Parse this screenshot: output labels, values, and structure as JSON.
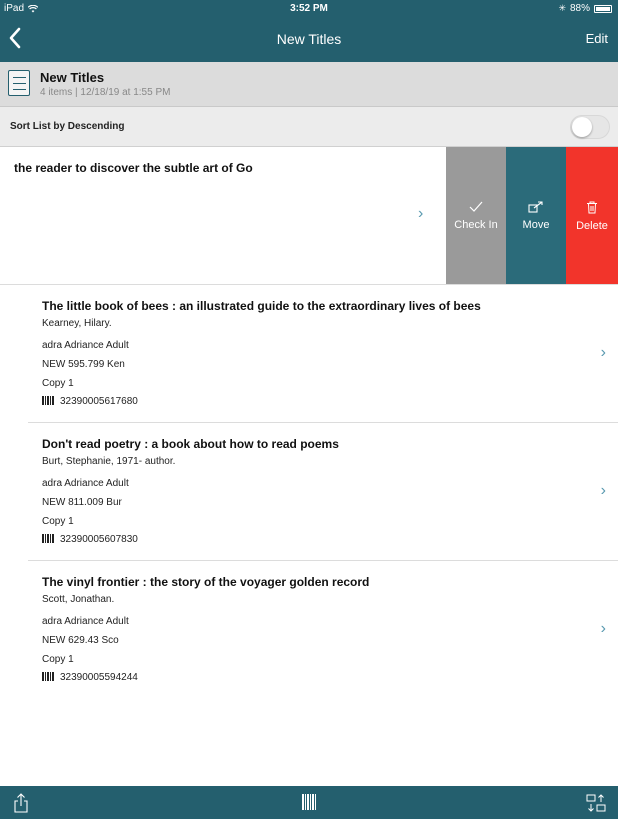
{
  "status_bar": {
    "device": "iPad",
    "time": "3:52 PM",
    "battery": "88%"
  },
  "nav": {
    "title": "New Titles",
    "edit_label": "Edit"
  },
  "list_header": {
    "title": "New Titles",
    "meta": "4 items  |  12/18/19 at 1:55 PM"
  },
  "sort": {
    "label": "Sort List by Descending",
    "enabled": false
  },
  "swiped_item": {
    "text": "the reader to discover the subtle art of Go",
    "actions": [
      {
        "label": "Check In",
        "icon": "checkmark-icon",
        "color": "#9a9a9a"
      },
      {
        "label": "Move",
        "icon": "move-icon",
        "color": "#2b6b7a"
      },
      {
        "label": "Delete",
        "icon": "trash-icon",
        "color": "#f2342b"
      }
    ]
  },
  "items": [
    {
      "title": "The little book of bees : an illustrated guide to the extraordinary lives of bees",
      "author": "Kearney, Hilary.",
      "location": "adra Adriance Adult",
      "call_number": "NEW 595.799 Ken",
      "copy": "Copy 1",
      "barcode": "32390005617680"
    },
    {
      "title": "Don't read poetry : a book about how to read poems",
      "author": "Burt, Stephanie, 1971- author.",
      "location": "adra Adriance Adult",
      "call_number": "NEW 811.009 Bur",
      "copy": "Copy 1",
      "barcode": "32390005607830"
    },
    {
      "title": "The vinyl frontier : the story of the voyager golden record",
      "author": "Scott, Jonathan.",
      "location": "adra Adriance Adult",
      "call_number": "NEW 629.43 Sco",
      "copy": "Copy 1",
      "barcode": "32390005594244"
    }
  ],
  "toolbar": {
    "left_icon": "share-icon",
    "center_icon": "barcode-scan-icon",
    "right_icon": "sort-transfer-icon"
  },
  "colors": {
    "brand": "#245f6e",
    "accent_chevron": "#5a9ab0",
    "delete": "#f2342b",
    "check_in": "#9a9a9a",
    "move": "#2b6b7a"
  }
}
